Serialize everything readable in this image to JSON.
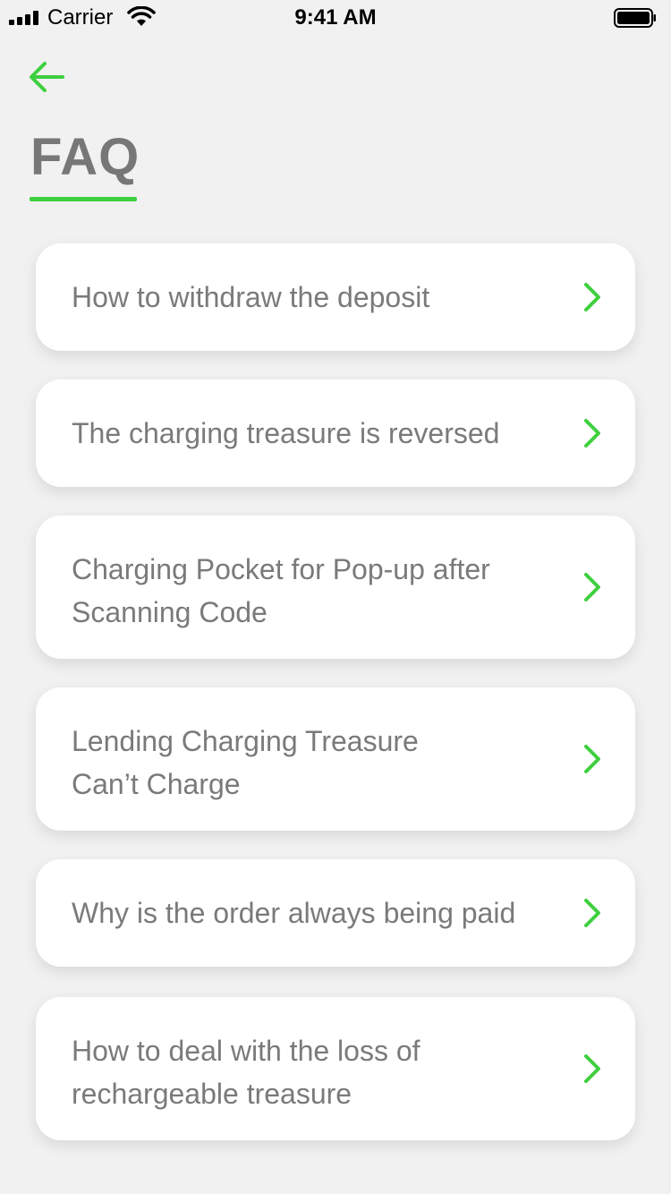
{
  "status_bar": {
    "carrier": "Carrier",
    "time": "9:41 AM"
  },
  "header": {
    "back_icon": "arrow-left-icon",
    "title": "FAQ"
  },
  "colors": {
    "accent": "#3ecf3e",
    "text_gray": "#7a7a7a",
    "background": "#f1f1f1",
    "card": "#ffffff"
  },
  "faq": {
    "items": [
      {
        "label": "How to withdraw the deposit",
        "icon": "chevron-right-icon"
      },
      {
        "label": "The charging treasure is reversed",
        "icon": "chevron-right-icon"
      },
      {
        "label": "Charging Pocket for Pop-up after\nScanning Code",
        "icon": "chevron-right-icon"
      },
      {
        "label": "Lending Charging Treasure\nCan’t Charge",
        "icon": "chevron-right-icon"
      },
      {
        "label": "Why is the order always being paid",
        "icon": "chevron-right-icon"
      },
      {
        "label": "How to deal with the loss of\nrechargeable treasure",
        "icon": "chevron-right-icon"
      }
    ]
  }
}
